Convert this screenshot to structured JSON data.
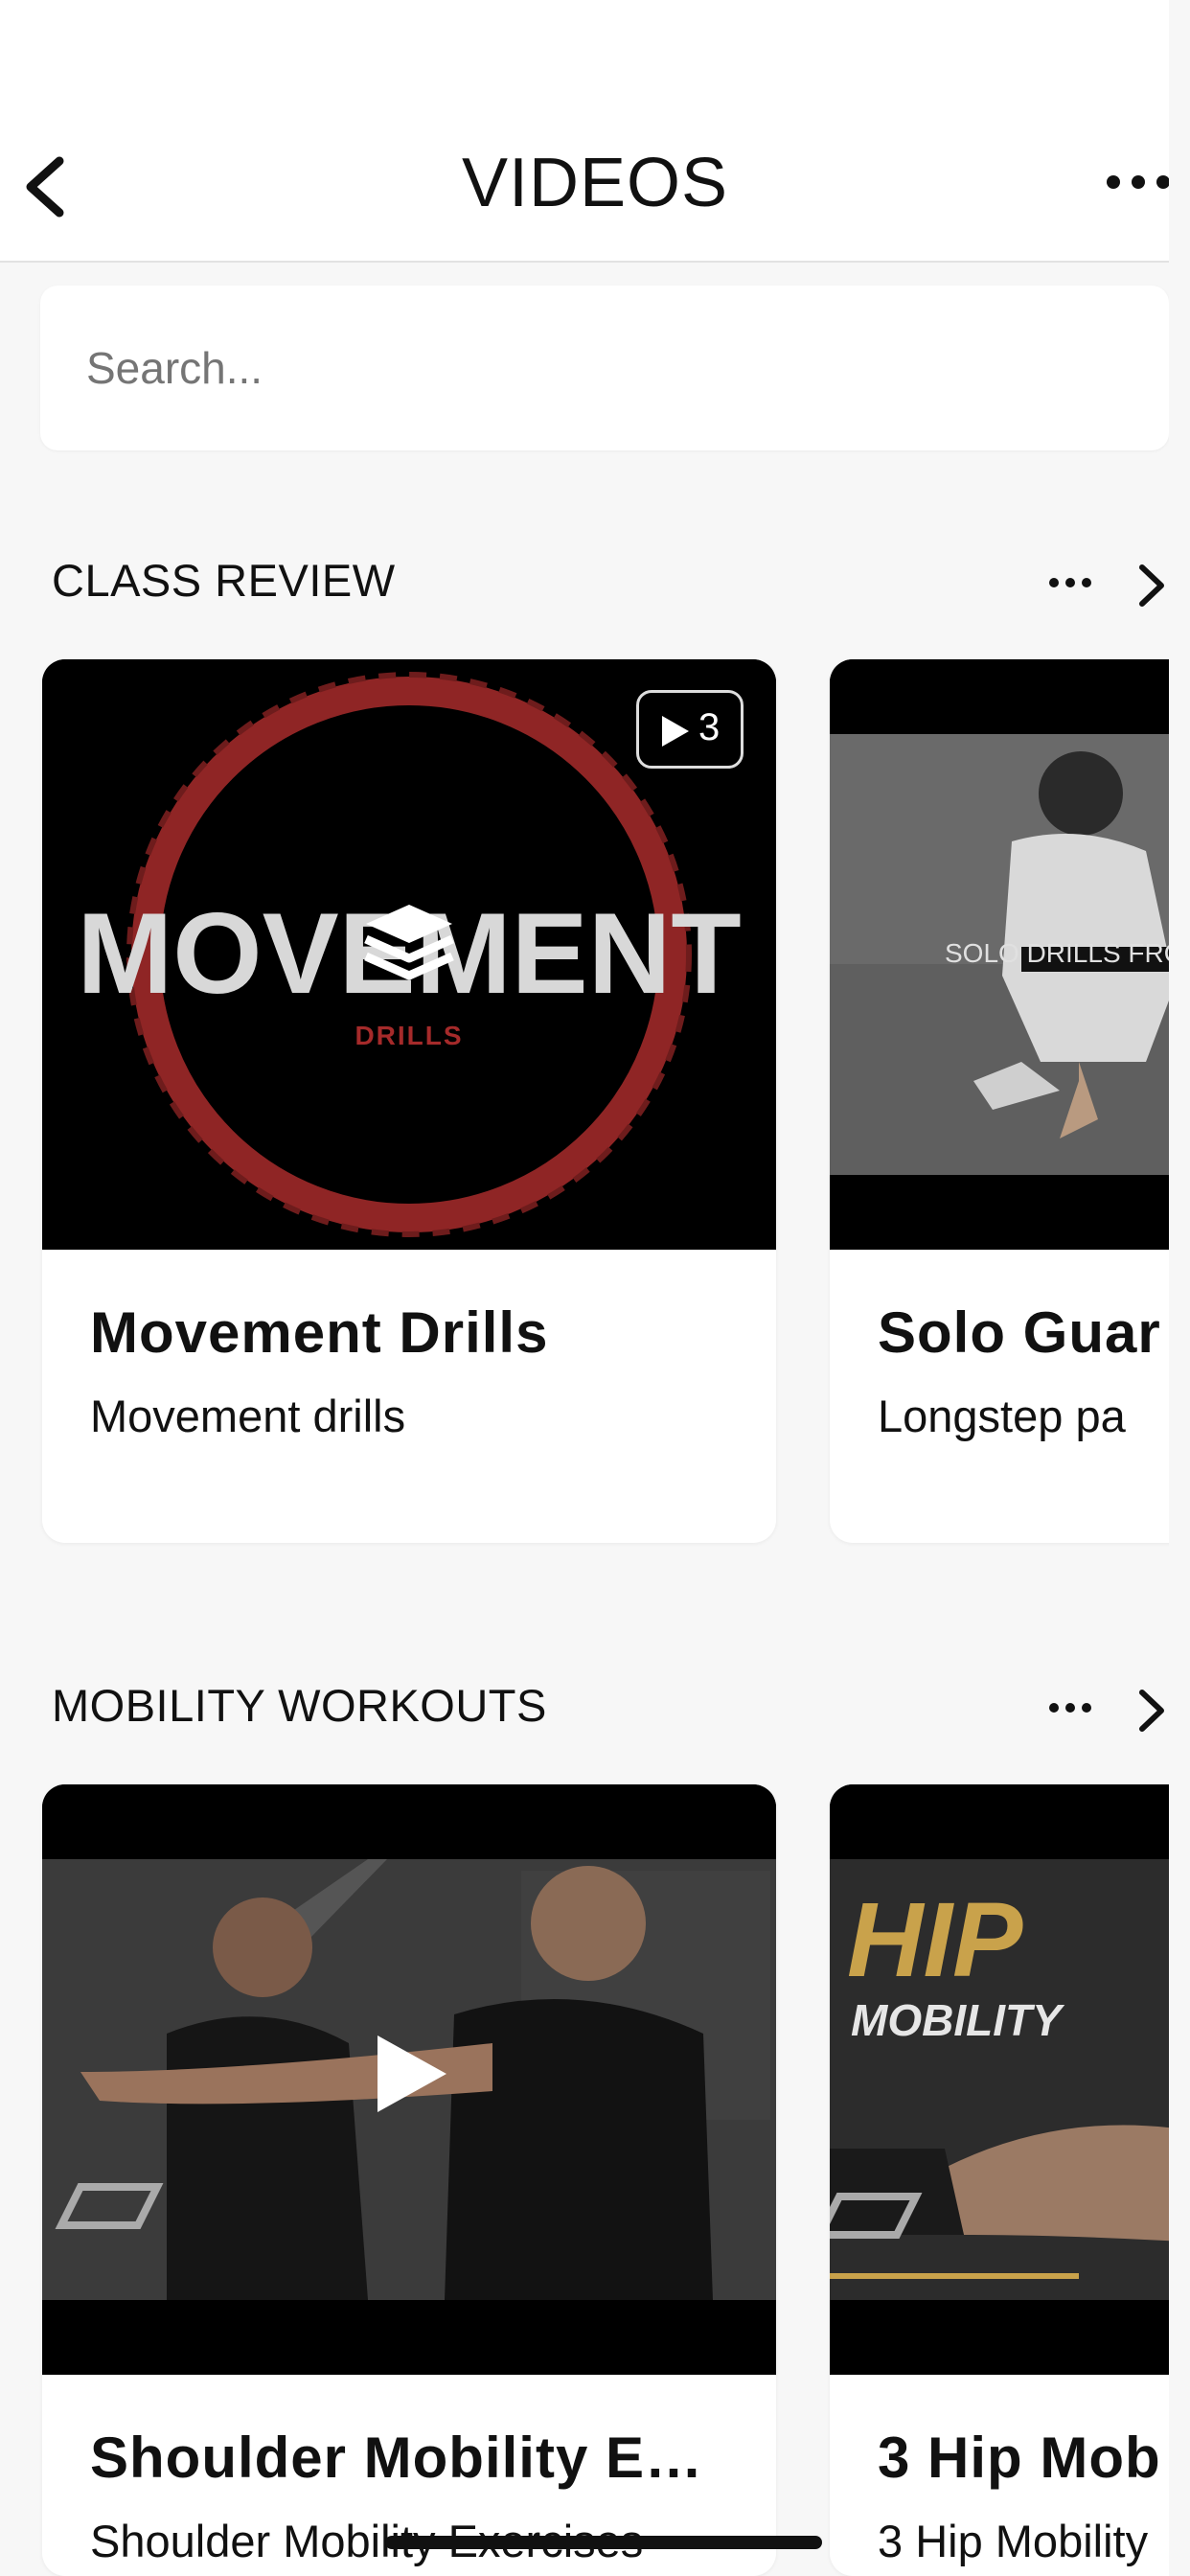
{
  "header": {
    "title": "VIDEOS",
    "back_icon": "chevron-left-icon",
    "more_icon": "more-horizontal-icon"
  },
  "search": {
    "placeholder": "Search..."
  },
  "sections": [
    {
      "title": "CLASS REVIEW",
      "cards": [
        {
          "title": "Movement Drills",
          "subtitle": "Movement drills",
          "badge_count": "3",
          "thumb_text": "MOVEMENT",
          "thumb_subtext": "DRILLS",
          "overlay_icon": "layers-icon"
        },
        {
          "title": "Solo Guar",
          "subtitle": "Longstep pa",
          "thumb_text": "SOLO DRILLS FROM T"
        }
      ]
    },
    {
      "title": "MOBILITY WORKOUTS",
      "cards": [
        {
          "title": "Shoulder Mobility E…",
          "subtitle": "Shoulder Mobility Exercises",
          "overlay_icon": "play-icon"
        },
        {
          "title": "3 Hip Mob",
          "subtitle": "3 Hip Mobility",
          "thumb_text": "HIP",
          "thumb_subtext": "MOBILITY"
        }
      ]
    }
  ],
  "colors": {
    "accent_red": "#8f2525",
    "gold": "#c9a24b"
  }
}
